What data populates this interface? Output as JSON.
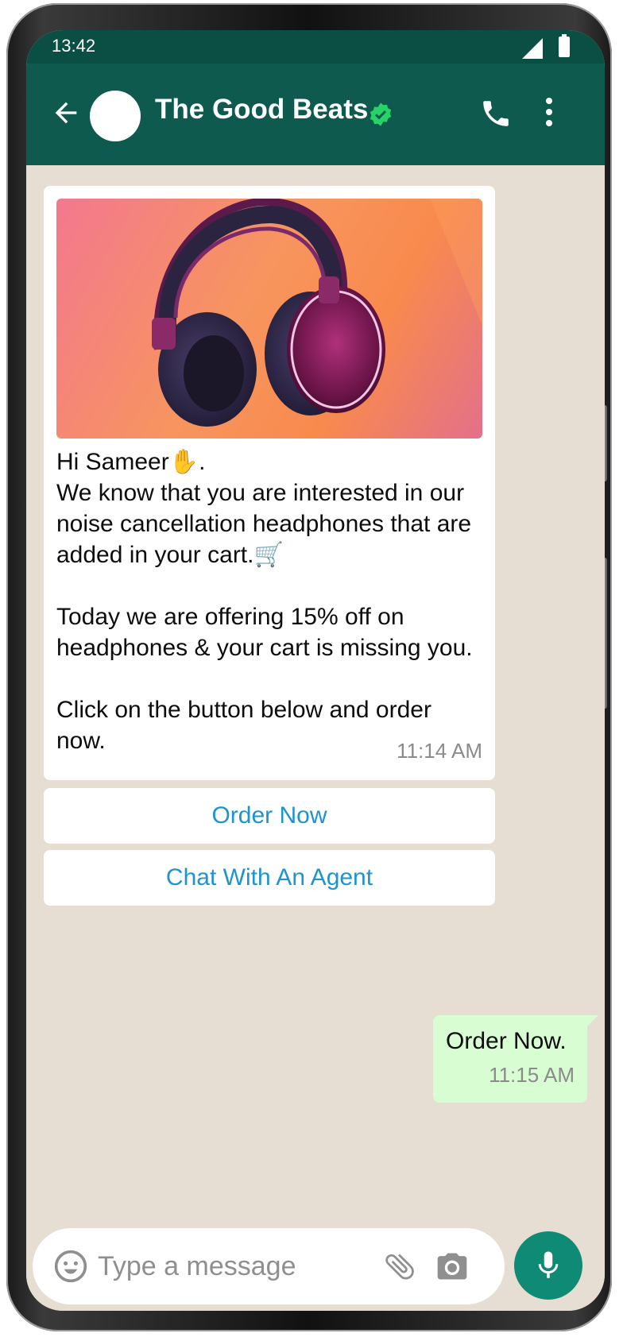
{
  "status_bar": {
    "time": "13:42"
  },
  "header": {
    "contact_name": "The Good Beats",
    "icons": [
      "back-arrow-icon",
      "verified-badge-icon",
      "phone-call-icon",
      "more-vertical-icon"
    ]
  },
  "chat": {
    "incoming_message": {
      "image": "headphones-promo-image",
      "text": "Hi Sameer✋.\nWe know that you are interested in our noise cancellation headphones that are added in your cart.🛒\n\nToday we are offering 15% off on headphones & your cart is missing you.\n\nClick on the button below and order now.",
      "time": "11:14 AM"
    },
    "quick_replies": [
      "Order Now",
      "Chat With An Agent"
    ],
    "outgoing_message": {
      "text": "Order Now.",
      "time": "11:15 AM"
    }
  },
  "composer": {
    "placeholder": "Type a message",
    "icons": [
      "emoji-icon",
      "attachment-icon",
      "camera-icon",
      "microphone-icon"
    ]
  },
  "colors": {
    "header_bg": "#0e5a4e",
    "chat_bg": "#e6ded2",
    "outgoing_bubble": "#d9fdd3",
    "link_blue": "#1d93d2",
    "mic_button": "#0e8a75",
    "verified_green": "#25d366"
  }
}
